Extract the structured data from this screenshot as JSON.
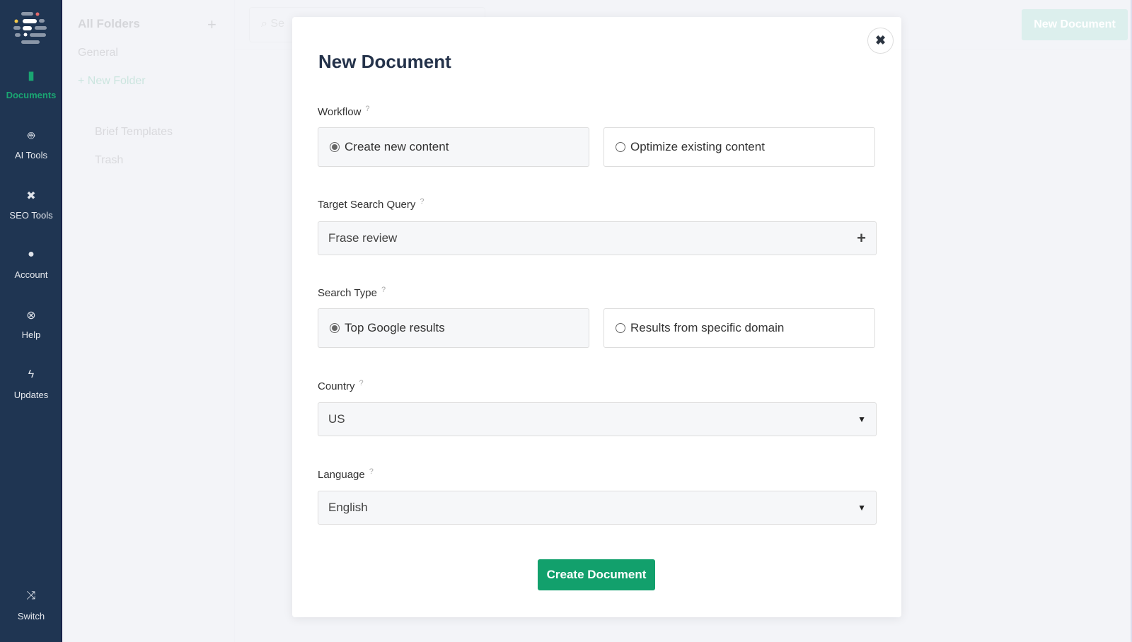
{
  "sidebar": {
    "items": [
      {
        "label": "Documents",
        "icon": "document-icon"
      },
      {
        "label": "AI Tools",
        "icon": "robot-icon"
      },
      {
        "label": "SEO Tools",
        "icon": "tools-icon"
      },
      {
        "label": "Account",
        "icon": "user-icon"
      },
      {
        "label": "Help",
        "icon": "lifering-icon"
      },
      {
        "label": "Updates",
        "icon": "bolt-icon"
      },
      {
        "label": "Switch",
        "icon": "shuffle-icon"
      }
    ]
  },
  "folders": {
    "title": "All Folders",
    "general": "General",
    "new_folder": "+ New Folder",
    "brief_templates": "Brief Templates",
    "trash": "Trash"
  },
  "topbar": {
    "search_placeholder": "Se",
    "new_document": "New Document"
  },
  "modal": {
    "title": "New Document",
    "help": "?",
    "workflow": {
      "label": "Workflow",
      "options": [
        "Create new content",
        "Optimize existing content"
      ],
      "selected": 0
    },
    "query": {
      "label": "Target Search Query",
      "value": "Frase review"
    },
    "search_type": {
      "label": "Search Type",
      "options": [
        "Top Google results",
        "Results from specific domain"
      ],
      "selected": 0
    },
    "country": {
      "label": "Country",
      "value": "US"
    },
    "language": {
      "label": "Language",
      "value": "English"
    },
    "submit": "Create Document"
  },
  "colors": {
    "sidebar": "#1f3552",
    "accent": "#12a06c"
  }
}
